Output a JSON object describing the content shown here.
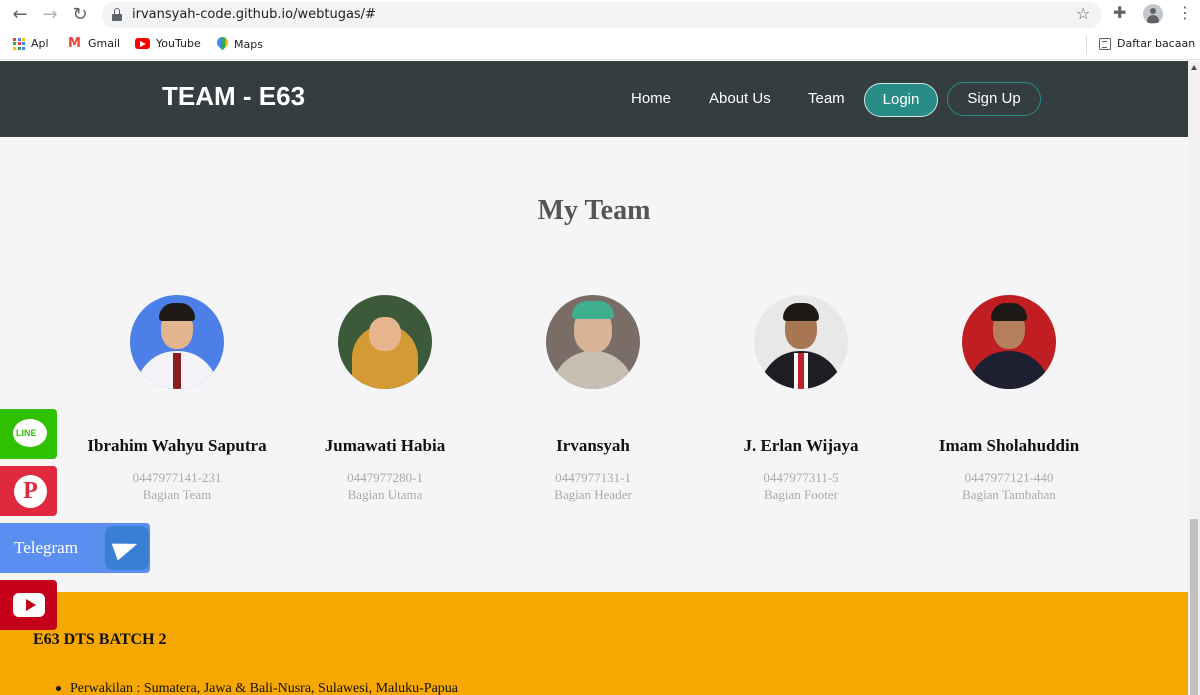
{
  "browser": {
    "url": "irvansyah-code.github.io/webtugas/#",
    "bookmarks": [
      "Apl",
      "Gmail",
      "YouTube",
      "Maps"
    ],
    "reading_list": "Daftar bacaan"
  },
  "site": {
    "brand": "TEAM - E63",
    "nav": [
      "Home",
      "About Us",
      "Team"
    ],
    "login": "Login",
    "signup": "Sign Up"
  },
  "team": {
    "title": "My Team",
    "members": [
      {
        "name": "Ibrahim Wahyu Saputra",
        "id": "0447977141-231",
        "role": "Bagian Team"
      },
      {
        "name": "Jumawati Habia",
        "id": "0447977280-1",
        "role": "Bagian Utama"
      },
      {
        "name": "Irvansyah",
        "id": "0447977131-1",
        "role": "Bagian Header"
      },
      {
        "name": "J. Erlan Wijaya",
        "id": "0447977311-5",
        "role": "Bagian Footer"
      },
      {
        "name": "Imam Sholahuddin",
        "id": "0447977121-440",
        "role": "Bagian Tambahan"
      }
    ]
  },
  "footer": {
    "title": "E63 DTS BATCH 2",
    "items": [
      "Perwakilan : Sumatera, Jawa & Bali-Nusra, Sulawesi, Maluku-Papua"
    ]
  },
  "social": {
    "line": "LINE",
    "telegram": "Telegram",
    "pinterest_glyph": "P"
  },
  "colors": {
    "navbar": "#343d40",
    "accent_teal": "#2a8c86",
    "footer": "#f6a800",
    "line": "#2fc000",
    "pinterest": "#e0293f",
    "telegram": "#5a8ff0",
    "youtube": "#c4001a"
  }
}
